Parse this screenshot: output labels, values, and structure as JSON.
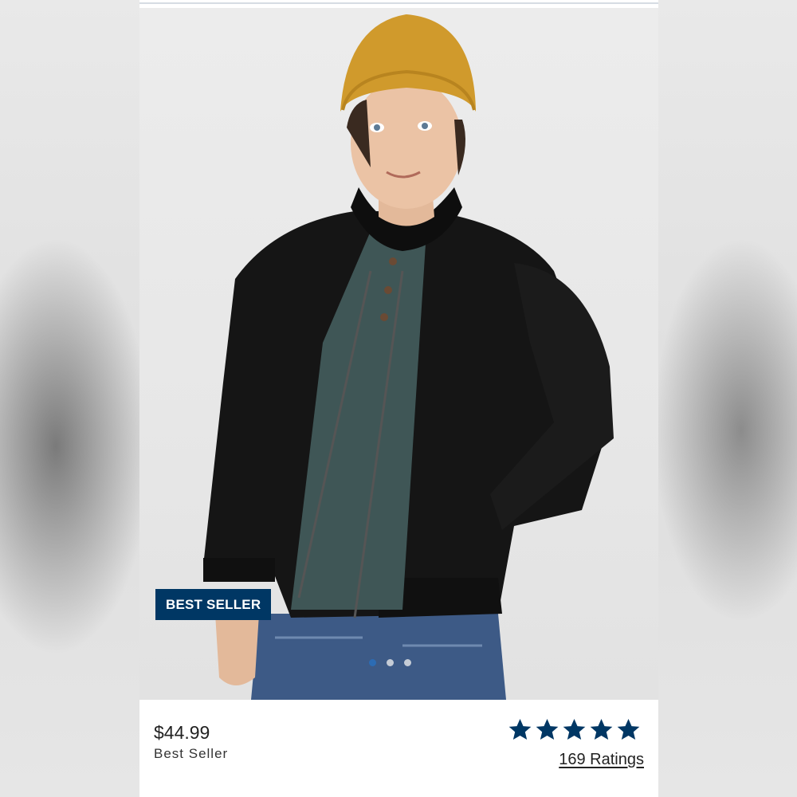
{
  "product": {
    "image_alt": "Kid wearing black bomber jacket, mustard beanie, green henley and jeans",
    "badge": "BEST SELLER",
    "carousel": {
      "count": 3,
      "active_index": 0
    },
    "price": "$44.99",
    "subtitle": "Best Seller",
    "rating": {
      "stars": 5,
      "max": 5,
      "label": "169 Ratings"
    }
  },
  "colors": {
    "badge": "#003764",
    "star": "#003764",
    "dot_active": "#2c6cb4",
    "dot_inactive": "#c5ccd6"
  },
  "icons": {
    "star": "star-icon"
  }
}
